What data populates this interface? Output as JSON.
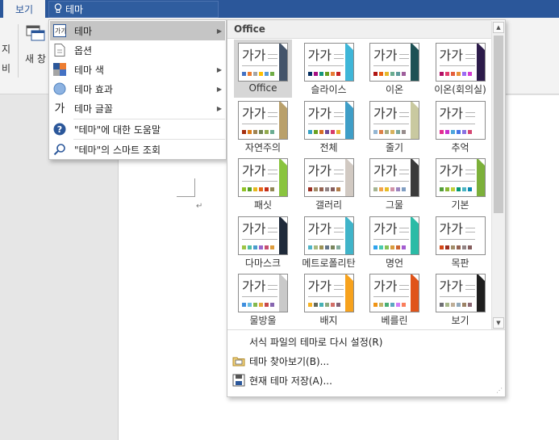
{
  "ribbon": {
    "active_tab": "보기",
    "tell_me": "테마",
    "fragments": [
      "지",
      "비",
      "새 창"
    ]
  },
  "menu": {
    "items": [
      {
        "label": "테마",
        "icon": "theme-icon",
        "submenu": true,
        "active": true
      },
      {
        "label": "옵션",
        "icon": "options-icon",
        "submenu": false
      },
      {
        "label": "테마 색",
        "icon": "theme-colors-icon",
        "submenu": true
      },
      {
        "label": "테마 효과",
        "icon": "theme-effects-icon",
        "submenu": true
      },
      {
        "label": "테마 글꼴",
        "icon": "theme-fonts-icon",
        "submenu": true
      },
      {
        "label": "\"테마\"에 대한 도움말",
        "icon": "help-icon",
        "submenu": false
      },
      {
        "label": "\"테마\"의 스마트 조회",
        "icon": "smart-lookup-icon",
        "submenu": false
      }
    ]
  },
  "gallery": {
    "header": "Office",
    "sample_text": "가가",
    "themes": [
      {
        "name": "Office",
        "accent": "#44546a",
        "palette": [
          "#4472c4",
          "#ed7d31",
          "#a5a5a5",
          "#ffc000",
          "#5b9bd5",
          "#70ad47"
        ]
      },
      {
        "name": "슬라이스",
        "accent": "#3fb6d8",
        "palette": [
          "#052f61",
          "#a50e82",
          "#14967c",
          "#6a9e1f",
          "#e87d37",
          "#c62324"
        ]
      },
      {
        "name": "이온",
        "accent": "#1e5155",
        "palette": [
          "#b01513",
          "#ea6312",
          "#e6b729",
          "#6aac90",
          "#5f9c9d",
          "#9e5e9b"
        ]
      },
      {
        "name": "이온(회의실)",
        "accent": "#2c1b4a",
        "palette": [
          "#b31166",
          "#e33d6f",
          "#e45f3c",
          "#e9943a",
          "#9b6bf2",
          "#d53dd0"
        ]
      },
      {
        "name": "자연주의",
        "accent": "#b9a06b",
        "palette": [
          "#a53010",
          "#de7e18",
          "#9f8351",
          "#728653",
          "#92aa4c",
          "#6aac91"
        ]
      },
      {
        "name": "전체",
        "accent": "#3f9ec7",
        "palette": [
          "#35a2c6",
          "#69a120",
          "#d86c24",
          "#6d4b9a",
          "#d73b6a",
          "#e8b430"
        ]
      },
      {
        "name": "줄기",
        "accent": "#c9c9a0",
        "palette": [
          "#94b6d2",
          "#dd8047",
          "#a5ab81",
          "#d8b25c",
          "#7ba79d",
          "#968c8c"
        ]
      },
      {
        "name": "추억",
        "accent": "#ffffff",
        "palette": [
          "#e32d91",
          "#c830cc",
          "#4ea6dc",
          "#4775e7",
          "#8971e1",
          "#d54773"
        ]
      },
      {
        "name": "패싯",
        "accent": "#8ac43f",
        "palette": [
          "#90c226",
          "#54a021",
          "#e6b91e",
          "#e76618",
          "#c42f1a",
          "#918655"
        ]
      },
      {
        "name": "갤러리",
        "accent": "#d1c9c2",
        "palette": [
          "#9b2d1f",
          "#a28e6a",
          "#956251",
          "#918485",
          "#855d5d",
          "#b27d49"
        ]
      },
      {
        "name": "그물",
        "accent": "#3a3a3a",
        "palette": [
          "#a5b592",
          "#f3a447",
          "#e7bc29",
          "#d092a7",
          "#9c85c0",
          "#809ec2"
        ]
      },
      {
        "name": "기본",
        "accent": "#7cb03a",
        "palette": [
          "#549e39",
          "#8ab833",
          "#c0cf3a",
          "#029676",
          "#4ab5c4",
          "#0989b1"
        ]
      },
      {
        "name": "다마스크",
        "accent": "#1f2a3a",
        "palette": [
          "#9ec544",
          "#50bea3",
          "#4a9ccc",
          "#9a66ca",
          "#c54f71",
          "#de9c3c"
        ]
      },
      {
        "name": "메트로폴리탄",
        "accent": "#40b4c9",
        "palette": [
          "#50b4c8",
          "#a8b97f",
          "#9b9256",
          "#657689",
          "#7a855d",
          "#84ac9d"
        ]
      },
      {
        "name": "명언",
        "accent": "#2bbba6",
        "palette": [
          "#2fa3ee",
          "#4bcaad",
          "#86c157",
          "#d99c3f",
          "#ce6633",
          "#a35dd1"
        ]
      },
      {
        "name": "목판",
        "accent": "#ffffff",
        "palette": [
          "#d34817",
          "#9b2d1f",
          "#a28e6a",
          "#956251",
          "#918485",
          "#855d5d"
        ]
      },
      {
        "name": "물방울",
        "accent": "#c9c9c9",
        "palette": [
          "#3e8ede",
          "#69bbe0",
          "#84b94c",
          "#e8a53a",
          "#c84a4a",
          "#8665b0"
        ]
      },
      {
        "name": "배지",
        "accent": "#f7a21d",
        "palette": [
          "#f8b323",
          "#656a59",
          "#46b2b5",
          "#8caa7e",
          "#d36f68",
          "#826276"
        ]
      },
      {
        "name": "베를린",
        "accent": "#e0541a",
        "palette": [
          "#f09415",
          "#c1b56b",
          "#4baf73",
          "#5aa6c0",
          "#d17df9",
          "#fa7e5c"
        ]
      },
      {
        "name": "보기",
        "accent": "#1e1e1e",
        "palette": [
          "#6f6f74",
          "#a7b789",
          "#beae98",
          "#92a9b9",
          "#9c8265",
          "#8d6974"
        ]
      }
    ],
    "actions": [
      {
        "label": "서식 파일의 테마로 다시 설정(R)",
        "icon": ""
      },
      {
        "label": "테마 찾아보기(B)...",
        "icon": "browse-themes-icon"
      },
      {
        "label": "현재 테마 저장(A)...",
        "icon": "save-theme-icon"
      }
    ]
  }
}
